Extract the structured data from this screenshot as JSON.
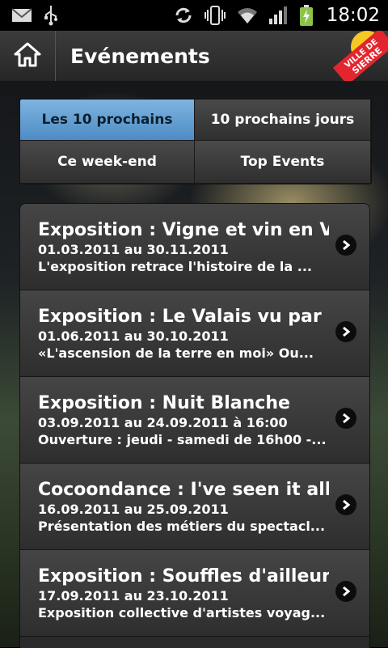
{
  "status_bar": {
    "time": "18:02",
    "icons": [
      "gmail-icon",
      "usb-icon",
      "sync-icon",
      "vibrate-icon",
      "wifi-icon",
      "signal-icon",
      "battery-charging-icon"
    ]
  },
  "action_bar": {
    "title": "Evénements",
    "home_icon": "home-icon",
    "logo_text_1": "VILLE DE",
    "logo_text_2": "SIERRE"
  },
  "tabs": [
    {
      "label": "Les 10 prochains",
      "active": true
    },
    {
      "label": "10 prochains jours",
      "active": false
    },
    {
      "label": "Ce week-end",
      "active": false
    },
    {
      "label": "Top Events",
      "active": false
    }
  ],
  "events": [
    {
      "title": "Exposition : Vigne et vin en V...",
      "date": "01.03.2011 au 30.11.2011",
      "desc": "L'exposition retrace l'histoire de la ..."
    },
    {
      "title": "Exposition : Le Valais vu par ...",
      "date": "01.06.2011 au 30.10.2011",
      "desc": "«L'ascension de la terre en moi» Ou..."
    },
    {
      "title": "Exposition : Nuit Blanche",
      "date": "03.09.2011 au 24.09.2011 à 16:00",
      "desc": "Ouverture : jeudi - samedi de 16h00 -..."
    },
    {
      "title": "Cocoondance : I've seen it all",
      "date": "16.09.2011 au 25.09.2011",
      "desc": "Présentation des métiers du spectacl..."
    },
    {
      "title": "Exposition : Souffles d'ailleurs",
      "date": "17.09.2011 au 23.10.2011",
      "desc": "Exposition collective d'artistes voyag..."
    }
  ],
  "colors": {
    "tab_active": "#5b9bd5",
    "chevron_bg": "#0c0c0c",
    "logo_red": "#e3262e",
    "logo_yellow": "#f7c823"
  }
}
